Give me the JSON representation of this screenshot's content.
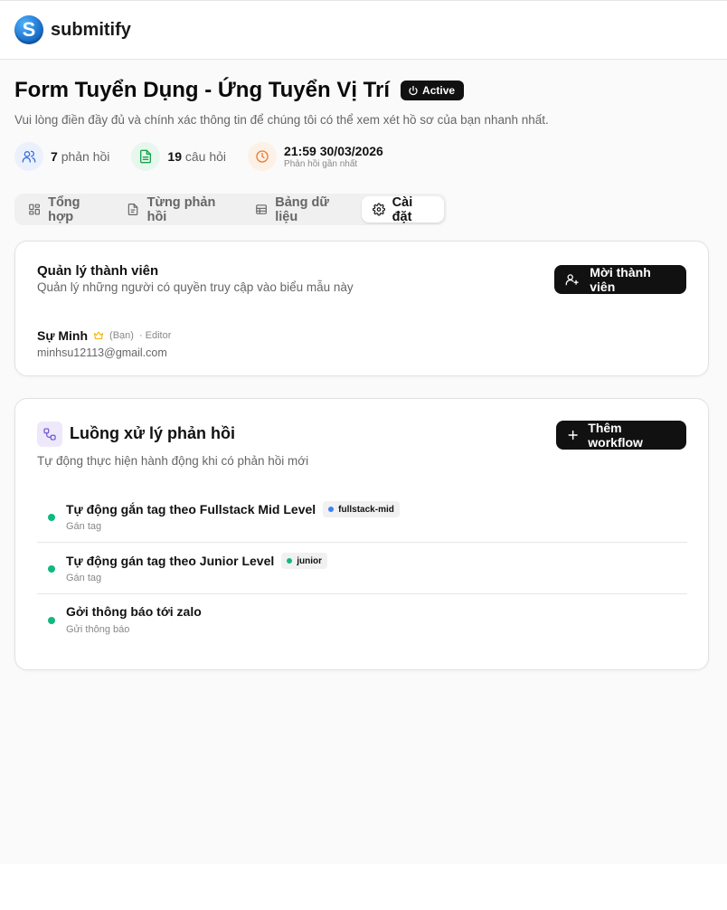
{
  "app": {
    "name": "submitify",
    "logo_letter": "S"
  },
  "form": {
    "title": "Form Tuyển Dụng - Ứng Tuyển Vị Trí",
    "status": "Active",
    "description": "Vui lòng điền đầy đủ và chính xác thông tin để chúng tôi có thể xem xét hồ sơ của bạn nhanh nhất."
  },
  "stats": {
    "responses_count": "7",
    "responses_label": "phản hồi",
    "questions_count": "19",
    "questions_label": "câu hỏi",
    "last_time": "21:59 30/03/2026",
    "last_label": "Phản hồi gần nhất"
  },
  "tabs": [
    {
      "label": "Tổng hợp",
      "icon": "grid-icon"
    },
    {
      "label": "Từng phản hồi",
      "icon": "document-icon"
    },
    {
      "label": "Bảng dữ liệu",
      "icon": "table-icon"
    },
    {
      "label": "Cài đặt",
      "icon": "gear-icon",
      "active": true
    }
  ],
  "members": {
    "title": "Quản lý thành viên",
    "description": "Quản lý những người có quyền truy cập vào biểu mẫu này",
    "invite_label": "Mời thành viên",
    "list": [
      {
        "name": "Sự Minh",
        "you": "(Bạn)",
        "role": "· Editor",
        "email": "minhsu12113@gmail.com"
      }
    ]
  },
  "workflow": {
    "title": "Luồng xử lý phản hồi",
    "description": "Tự động thực hiện hành động khi có phản hồi mới",
    "add_label": "Thêm workflow",
    "items": [
      {
        "name": "Tự động gắn tag theo Fullstack Mid Level",
        "tag": "fullstack-mid",
        "tag_color": "#3b82f6",
        "type": "Gán tag"
      },
      {
        "name": "Tự động gán tag theo Junior Level",
        "tag": "junior",
        "tag_color": "#10b981",
        "type": "Gán tag"
      },
      {
        "name": "Gởi thông báo tới zalo",
        "tag": "",
        "type": "Gửi thông báo"
      }
    ]
  },
  "colors": {
    "accent_dark": "#111111",
    "status_active_dot": "#10b981",
    "responses_icon": "#3b6fd8",
    "questions_icon": "#16a34a",
    "time_icon": "#ea7a2a",
    "crown": "#f5b400",
    "workflow_icon": "#7c5cdb"
  }
}
